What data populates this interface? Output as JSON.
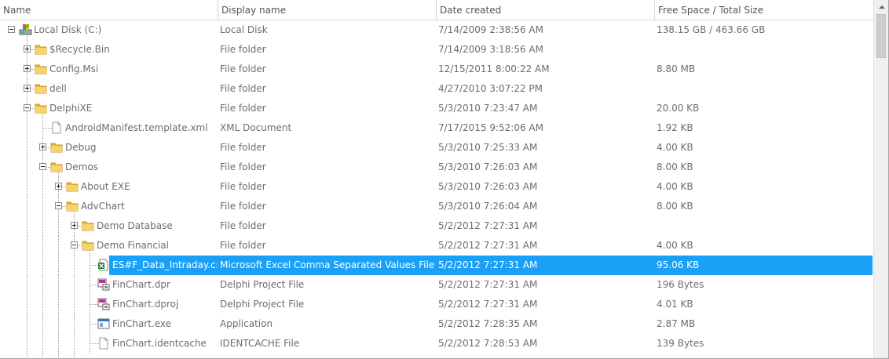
{
  "columns": [
    "Name",
    "Display name",
    "Date created",
    "Free Space / Total Size"
  ],
  "rows": [
    {
      "level": 0,
      "expander": "minus",
      "icon": "drive-icon",
      "name": "Local Disk (C:)",
      "display": "Local Disk",
      "date": "7/14/2009 2:38:56 AM",
      "size": "138.15 GB / 463.66 GB"
    },
    {
      "level": 1,
      "expander": "plus",
      "icon": "folder-icon",
      "name": "$Recycle.Bin",
      "display": "File folder",
      "date": "7/14/2009 3:18:56 AM",
      "size": ""
    },
    {
      "level": 1,
      "expander": "plus",
      "icon": "folder-icon",
      "name": "Config.Msi",
      "display": "File folder",
      "date": "12/15/2011 8:00:22 AM",
      "size": "8.80 MB"
    },
    {
      "level": 1,
      "expander": "plus",
      "icon": "folder-icon",
      "name": "dell",
      "display": "File folder",
      "date": "4/27/2010 3:07:22 PM",
      "size": ""
    },
    {
      "level": 1,
      "expander": "minus",
      "icon": "folder-icon",
      "name": "DelphiXE",
      "display": "File folder",
      "date": "5/3/2010 7:23:47 AM",
      "size": "20.00 KB"
    },
    {
      "level": 2,
      "expander": "none",
      "icon": "file-icon",
      "name": "AndroidManifest.template.xml",
      "display": "XML Document",
      "date": "7/17/2015 9:52:06 AM",
      "size": "1.92 KB"
    },
    {
      "level": 2,
      "expander": "plus",
      "icon": "folder-icon",
      "name": "Debug",
      "display": "File folder",
      "date": "5/3/2010 7:25:33 AM",
      "size": "4.00 KB"
    },
    {
      "level": 2,
      "expander": "minus",
      "icon": "folder-icon",
      "name": "Demos",
      "display": "File folder",
      "date": "5/3/2010 7:26:03 AM",
      "size": "8.00 KB"
    },
    {
      "level": 3,
      "expander": "plus",
      "icon": "folder-icon",
      "name": "About EXE",
      "display": "File folder",
      "date": "5/3/2010 7:26:03 AM",
      "size": "4.00 KB"
    },
    {
      "level": 3,
      "expander": "minus",
      "icon": "folder-icon",
      "name": "AdvChart",
      "display": "File folder",
      "date": "5/3/2010 7:26:04 AM",
      "size": "8.00 KB"
    },
    {
      "level": 4,
      "expander": "plus",
      "icon": "folder-icon",
      "name": "Demo Database",
      "display": "File folder",
      "date": "5/2/2012 7:27:31 AM",
      "size": ""
    },
    {
      "level": 4,
      "expander": "minus",
      "icon": "folder-icon",
      "name": "Demo Financial",
      "display": "File folder",
      "date": "5/2/2012 7:27:31 AM",
      "size": "4.00 KB"
    },
    {
      "level": 5,
      "expander": "none",
      "icon": "excel-csv-icon",
      "name": "ES#F_Data_Intraday.csv",
      "display": "Microsoft Excel Comma Separated Values File",
      "date": "5/2/2012 7:27:31 AM",
      "size": "95.06 KB",
      "selected": true
    },
    {
      "level": 5,
      "expander": "none",
      "icon": "delphi-project-icon",
      "name": "FinChart.dpr",
      "display": "Delphi Project File",
      "date": "5/2/2012 7:27:31 AM",
      "size": "196 Bytes"
    },
    {
      "level": 5,
      "expander": "none",
      "icon": "delphi-project-icon",
      "name": "FinChart.dproj",
      "display": "Delphi Project File",
      "date": "5/2/2012 7:27:31 AM",
      "size": "4.01 KB"
    },
    {
      "level": 5,
      "expander": "none",
      "icon": "application-icon",
      "name": "FinChart.exe",
      "display": "Application",
      "date": "5/2/2012 7:28:35 AM",
      "size": "2.87 MB"
    },
    {
      "level": 5,
      "expander": "none",
      "icon": "file-icon",
      "name": "FinChart.identcache",
      "display": "IDENTCACHE File",
      "date": "5/2/2012 7:28:53 AM",
      "size": "139 Bytes"
    }
  ]
}
